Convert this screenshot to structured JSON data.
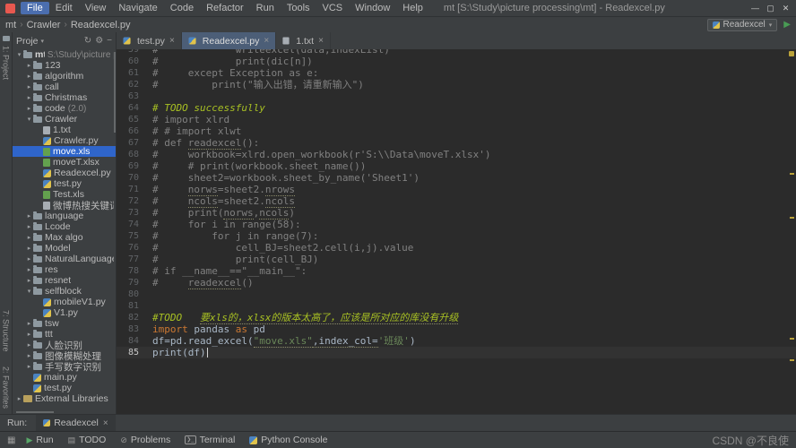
{
  "colors": {
    "selection_blue": "#2f65ca",
    "todo_yellow": "#A8C023",
    "keyword_orange": "#CC7832",
    "string_green": "#6A8759",
    "run_green": "#59A869",
    "accent_tab": "#4c5e77"
  },
  "icons": {
    "minimize": "—",
    "maximize": "▢",
    "close": "✕",
    "play": "▶",
    "chevron_down": "▾",
    "refresh": "↻",
    "gear": "⚙",
    "collapse": "−",
    "toggle": "▦",
    "breadcrumb_sep": "›",
    "run": "▶",
    "todo": "▤",
    "problems": "⊘",
    "terminal": "❯_",
    "tab_close": "×"
  },
  "titlebar": {
    "menus": [
      "File",
      "Edit",
      "View",
      "Navigate",
      "Code",
      "Refactor",
      "Run",
      "Tools",
      "VCS",
      "Window",
      "Help"
    ],
    "active_menu": 0,
    "title": "mt [S:\\Study\\picture processing\\mt] - Readexcel.py"
  },
  "navbar": {
    "breadcrumbs": [
      "mt",
      "Crawler",
      "Readexcel.py"
    ],
    "run_config": "Readexcel"
  },
  "left_stripe": {
    "project": "1: Project",
    "structure": "7: Structure",
    "favorites": "2: Favorites"
  },
  "project": {
    "header_label": "Proje",
    "items": [
      {
        "label": "mt",
        "hint": "S:\\Study\\picture pro",
        "depth": 0,
        "type": "folder",
        "expanded": true,
        "root": true
      },
      {
        "label": "123",
        "depth": 1,
        "type": "folder",
        "expanded": false
      },
      {
        "label": "algorithm",
        "depth": 1,
        "type": "folder",
        "expanded": false
      },
      {
        "label": "call",
        "depth": 1,
        "type": "folder",
        "expanded": false
      },
      {
        "label": "Christmas",
        "depth": 1,
        "type": "folder",
        "expanded": false
      },
      {
        "label": "code",
        "hint": "(2.0)",
        "depth": 1,
        "type": "folder",
        "expanded": false
      },
      {
        "label": "Crawler",
        "depth": 1,
        "type": "folder",
        "expanded": true
      },
      {
        "label": "1.txt",
        "depth": 2,
        "type": "txt"
      },
      {
        "label": "Crawler.py",
        "depth": 2,
        "type": "py"
      },
      {
        "label": "move.xls",
        "depth": 2,
        "type": "xls",
        "selected": true
      },
      {
        "label": "moveT.xlsx",
        "depth": 2,
        "type": "xls"
      },
      {
        "label": "Readexcel.py",
        "depth": 2,
        "type": "py"
      },
      {
        "label": "test.py",
        "depth": 2,
        "type": "py"
      },
      {
        "label": "Test.xls",
        "depth": 2,
        "type": "xls"
      },
      {
        "label": "微博热搜关键词词频",
        "depth": 2,
        "type": "file"
      },
      {
        "label": "language",
        "depth": 1,
        "type": "folder",
        "expanded": false
      },
      {
        "label": "Lcode",
        "depth": 1,
        "type": "folder",
        "expanded": false
      },
      {
        "label": "Max algo",
        "depth": 1,
        "type": "folder",
        "expanded": false
      },
      {
        "label": "Model",
        "depth": 1,
        "type": "folder",
        "expanded": false
      },
      {
        "label": "NaturalLanguageProc",
        "depth": 1,
        "type": "folder",
        "expanded": false
      },
      {
        "label": "res",
        "depth": 1,
        "type": "folder",
        "expanded": false
      },
      {
        "label": "resnet",
        "depth": 1,
        "type": "folder",
        "expanded": false
      },
      {
        "label": "selfblock",
        "depth": 1,
        "type": "folder",
        "expanded": true
      },
      {
        "label": "mobileV1.py",
        "depth": 2,
        "type": "py"
      },
      {
        "label": "V1.py",
        "depth": 2,
        "type": "py"
      },
      {
        "label": "tsw",
        "depth": 1,
        "type": "folder",
        "expanded": false
      },
      {
        "label": "ttt",
        "depth": 1,
        "type": "folder",
        "expanded": false
      },
      {
        "label": "人脸识别",
        "depth": 1,
        "type": "folder",
        "expanded": false
      },
      {
        "label": "图像模糊处理",
        "depth": 1,
        "type": "folder",
        "expanded": false
      },
      {
        "label": "手写数字识别",
        "depth": 1,
        "type": "folder",
        "expanded": false
      },
      {
        "label": "main.py",
        "depth": 1,
        "type": "py"
      },
      {
        "label": "test.py",
        "depth": 1,
        "type": "py"
      },
      {
        "label": "External Libraries",
        "depth": 0,
        "type": "lib",
        "expanded": false
      }
    ]
  },
  "editor": {
    "tabs": [
      {
        "label": "test.py",
        "type": "py"
      },
      {
        "label": "Readexcel.py",
        "type": "py",
        "active": true
      },
      {
        "label": "1.txt",
        "type": "txt"
      }
    ],
    "lines": [
      {
        "n": 59,
        "seg": [
          [
            "com",
            "#             writeexcel(data,indexList)"
          ]
        ]
      },
      {
        "n": 60,
        "seg": [
          [
            "com",
            "#             print(dic[n])"
          ]
        ]
      },
      {
        "n": 61,
        "seg": [
          [
            "com",
            "#     except Exception as e:"
          ]
        ]
      },
      {
        "n": 62,
        "seg": [
          [
            "com",
            "#         print(\"输入出错，请重新输入\")"
          ]
        ]
      },
      {
        "n": 63,
        "seg": []
      },
      {
        "n": 64,
        "seg": [
          [
            "todo",
            "# TODO successfully"
          ]
        ]
      },
      {
        "n": 65,
        "seg": [
          [
            "com",
            "# import xlrd"
          ]
        ]
      },
      {
        "n": 66,
        "seg": [
          [
            "com",
            "# # import xlwt"
          ]
        ]
      },
      {
        "n": 67,
        "seg": [
          [
            "com",
            "# def "
          ],
          [
            "com",
            "readexcel",
            "u"
          ],
          [
            "com",
            "():"
          ]
        ]
      },
      {
        "n": 68,
        "seg": [
          [
            "com",
            "#     workbook=xlrd.open_workbook(r'S:\\\\Data\\moveT.xlsx')"
          ]
        ]
      },
      {
        "n": 69,
        "seg": [
          [
            "com",
            "#     # print(workbook.sheet_name())"
          ]
        ]
      },
      {
        "n": 70,
        "seg": [
          [
            "com",
            "#     sheet2=workbook.sheet_by_name('Sheet1')"
          ]
        ]
      },
      {
        "n": 71,
        "seg": [
          [
            "com",
            "#     "
          ],
          [
            "com",
            "norws",
            "u"
          ],
          [
            "com",
            "=sheet2."
          ],
          [
            "com",
            "nrows",
            "u"
          ]
        ]
      },
      {
        "n": 72,
        "seg": [
          [
            "com",
            "#     "
          ],
          [
            "com",
            "ncols",
            "u"
          ],
          [
            "com",
            "=sheet2."
          ],
          [
            "com",
            "ncols",
            "u"
          ]
        ]
      },
      {
        "n": 73,
        "seg": [
          [
            "com",
            "#     print("
          ],
          [
            "com",
            "norws",
            "u"
          ],
          [
            "com",
            ","
          ],
          [
            "com",
            "ncols",
            "u"
          ],
          [
            "com",
            ")"
          ]
        ]
      },
      {
        "n": 74,
        "seg": [
          [
            "com",
            "#     for i in range(58):"
          ]
        ]
      },
      {
        "n": 75,
        "seg": [
          [
            "com",
            "#         for j in range(7):"
          ]
        ]
      },
      {
        "n": 76,
        "seg": [
          [
            "com",
            "#             cell_BJ=sheet2.cell(i,j).value"
          ]
        ]
      },
      {
        "n": 77,
        "seg": [
          [
            "com",
            "#             print(cell_BJ)"
          ]
        ]
      },
      {
        "n": 78,
        "seg": [
          [
            "com",
            "# if __name__==\"__main__\":"
          ]
        ]
      },
      {
        "n": 79,
        "seg": [
          [
            "com",
            "#     "
          ],
          [
            "com",
            "readexcel",
            "u"
          ],
          [
            "com",
            "()"
          ]
        ]
      },
      {
        "n": 80,
        "seg": []
      },
      {
        "n": 81,
        "seg": []
      },
      {
        "n": 82,
        "seg": [
          [
            "todo",
            "#TODO   "
          ],
          [
            "todo",
            "要xls的，xlsx的版本太高了，应该是所对应的库没有升级",
            "u"
          ]
        ]
      },
      {
        "n": 83,
        "seg": [
          [
            "kw",
            "import"
          ],
          [
            "pl",
            " pandas "
          ],
          [
            "kw",
            "as"
          ],
          [
            "pl",
            " pd"
          ]
        ]
      },
      {
        "n": 84,
        "seg": [
          [
            "pl",
            "df=pd.read_excel("
          ],
          [
            "str",
            "\"move.xls\"",
            "u"
          ],
          [
            "pl",
            ",index_col=",
            "u"
          ],
          [
            "str",
            "'班级'"
          ],
          [
            "pl",
            ")"
          ]
        ]
      },
      {
        "n": 85,
        "seg": [
          [
            "pl",
            "print(df)"
          ]
        ],
        "active": true,
        "caret": true
      }
    ]
  },
  "run_panel": {
    "label": "Run:",
    "tab": "Readexcel"
  },
  "statusbar": {
    "items": [
      {
        "icon": "run",
        "label": "Run"
      },
      {
        "icon": "todo",
        "label": "TODO"
      },
      {
        "icon": "problems",
        "label": "Problems"
      },
      {
        "icon": "terminal",
        "label": "Terminal"
      },
      {
        "icon": "python",
        "label": "Python Console"
      }
    ],
    "watermark": "CSDN @不良使"
  }
}
